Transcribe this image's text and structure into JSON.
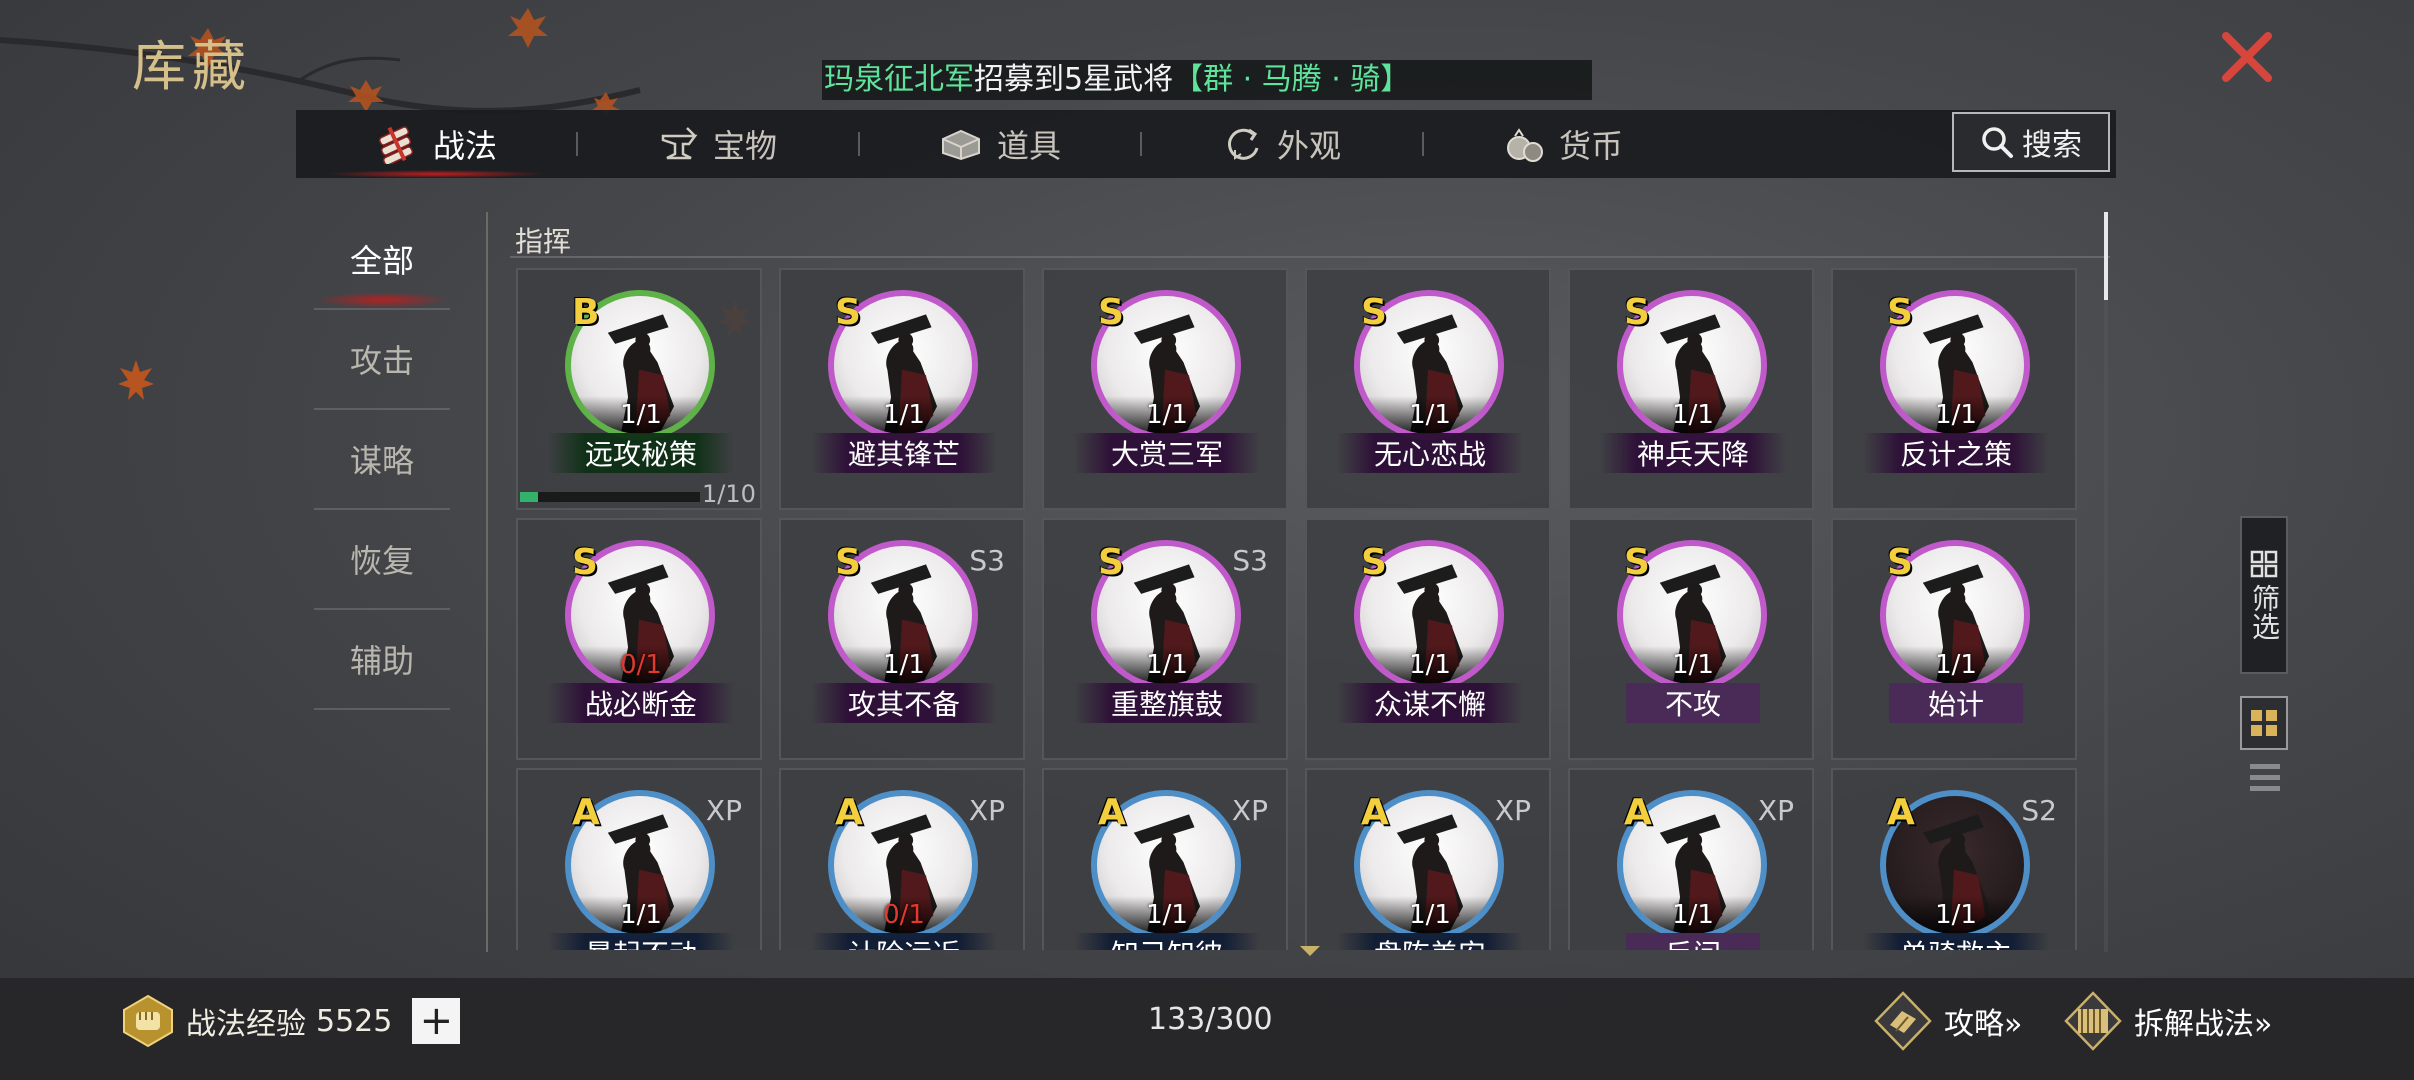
{
  "header": {
    "title": "库藏",
    "ticker_green": "玛泉征北军",
    "ticker_white": "招募到5星武将",
    "ticker_hero": "【群 · 马腾 · 骑】"
  },
  "tabs": [
    {
      "label": "战法",
      "icon": "scroll-bundle-icon",
      "active": true
    },
    {
      "label": "宝物",
      "icon": "anvil-icon",
      "active": false
    },
    {
      "label": "道具",
      "icon": "chest-icon",
      "active": false
    },
    {
      "label": "外观",
      "icon": "swirl-icon",
      "active": false
    },
    {
      "label": "货币",
      "icon": "money-bag-icon",
      "active": false
    }
  ],
  "search": {
    "label": "搜索",
    "icon": "search-icon"
  },
  "sidebar": {
    "items": [
      {
        "label": "全部",
        "active": true
      },
      {
        "label": "攻击",
        "active": false
      },
      {
        "label": "谋略",
        "active": false
      },
      {
        "label": "恢复",
        "active": false
      },
      {
        "label": "辅助",
        "active": false
      }
    ]
  },
  "section": {
    "label": "指挥"
  },
  "cards": [
    {
      "grade": "B",
      "tier": "",
      "name": "远攻秘策",
      "count": "1/1",
      "rarity": "b",
      "progress_label": "1/10",
      "progress": 0.1
    },
    {
      "grade": "S",
      "tier": "",
      "name": "避其锋芒",
      "count": "1/1",
      "rarity": "s"
    },
    {
      "grade": "S",
      "tier": "",
      "name": "大赏三军",
      "count": "1/1",
      "rarity": "s"
    },
    {
      "grade": "S",
      "tier": "",
      "name": "无心恋战",
      "count": "1/1",
      "rarity": "s"
    },
    {
      "grade": "S",
      "tier": "",
      "name": "神兵天降",
      "count": "1/1",
      "rarity": "s"
    },
    {
      "grade": "S",
      "tier": "",
      "name": "反计之策",
      "count": "1/1",
      "rarity": "s"
    },
    {
      "grade": "S",
      "tier": "",
      "name": "战必断金",
      "count": "0/1",
      "rarity": "s"
    },
    {
      "grade": "S",
      "tier": "S3",
      "name": "攻其不备",
      "count": "1/1",
      "rarity": "s"
    },
    {
      "grade": "S",
      "tier": "S3",
      "name": "重整旗鼓",
      "count": "1/1",
      "rarity": "s"
    },
    {
      "grade": "S",
      "tier": "",
      "name": "众谋不懈",
      "count": "1/1",
      "rarity": "s"
    },
    {
      "grade": "S",
      "tier": "",
      "name": "不攻",
      "count": "1/1",
      "rarity": "s"
    },
    {
      "grade": "S",
      "tier": "",
      "name": "始计",
      "count": "1/1",
      "rarity": "s"
    },
    {
      "grade": "A",
      "tier": "XP",
      "name": "暴起不动",
      "count": "1/1",
      "rarity": "a"
    },
    {
      "grade": "A",
      "tier": "XP",
      "name": "计险远近",
      "count": "0/1",
      "rarity": "a"
    },
    {
      "grade": "A",
      "tier": "XP",
      "name": "知己知彼",
      "count": "1/1",
      "rarity": "a"
    },
    {
      "grade": "A",
      "tier": "XP",
      "name": "盘陈美安",
      "count": "1/1",
      "rarity": "a"
    },
    {
      "grade": "A",
      "tier": "XP",
      "name": "反间",
      "count": "1/1",
      "rarity": "a"
    },
    {
      "grade": "A",
      "tier": "S2",
      "name": "单骑救主",
      "count": "1/1",
      "rarity": "a"
    }
  ],
  "filter": {
    "label": "筛选",
    "icon": "filter-grid-icon"
  },
  "footer": {
    "exp_label": "战法经验",
    "exp_value": "5525",
    "plus_label": "+",
    "capacity": "133/300",
    "guide_label": "攻略»",
    "disassemble_label": "拆解战法»"
  }
}
